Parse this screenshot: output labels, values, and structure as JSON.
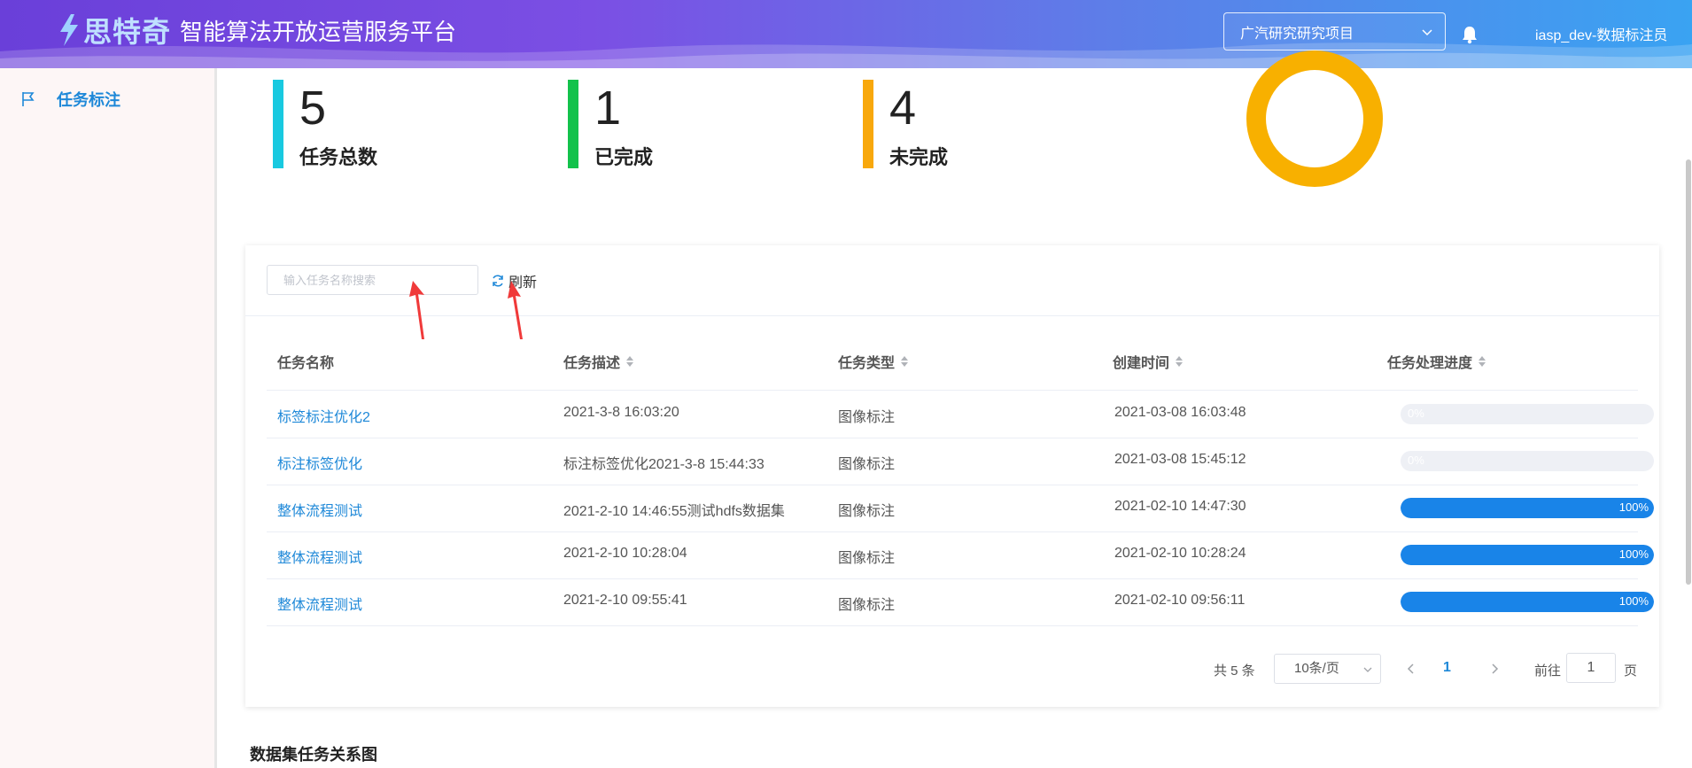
{
  "header": {
    "brand_name": "思特奇",
    "platform_title": "智能算法开放运营服务平台",
    "project_select": "广汽研究研究项目",
    "user_name": "iasp_dev-数据标注员",
    "colors": {
      "gradient_start": "#6a3fd9",
      "gradient_end": "#3aa3f2"
    }
  },
  "sidebar": {
    "items": [
      {
        "label": "任务标注",
        "icon": "flag-icon"
      }
    ]
  },
  "stats": [
    {
      "value": "5",
      "label": "任务总数",
      "color": "#18c9e0"
    },
    {
      "value": "1",
      "label": "已完成",
      "color": "#13c24b"
    },
    {
      "value": "4",
      "label": "未完成",
      "color": "#f8a80c"
    }
  ],
  "donut": {
    "color": "#f8b000",
    "completed": 1,
    "total": 5
  },
  "search": {
    "placeholder": "输入任务名称搜索"
  },
  "toolbar": {
    "refresh_label": "刷新"
  },
  "table": {
    "columns": [
      "任务名称",
      "任务描述",
      "任务类型",
      "创建时间",
      "任务处理进度"
    ],
    "rows": [
      {
        "name": "标签标注优化2",
        "description": "2021-3-8 16:03:20",
        "type": "图像标注",
        "created": "2021-03-08 16:03:48",
        "progress": 0,
        "progress_text": "0%"
      },
      {
        "name": "标注标签优化",
        "description": "标注标签优化2021-3-8 15:44:33",
        "type": "图像标注",
        "created": "2021-03-08 15:45:12",
        "progress": 0,
        "progress_text": "0%"
      },
      {
        "name": "整体流程测试",
        "description": "2021-2-10 14:46:55测试hdfs数据集",
        "type": "图像标注",
        "created": "2021-02-10 14:47:30",
        "progress": 100,
        "progress_text": "100%"
      },
      {
        "name": "整体流程测试",
        "description": "2021-2-10 10:28:04",
        "type": "图像标注",
        "created": "2021-02-10 10:28:24",
        "progress": 100,
        "progress_text": "100%"
      },
      {
        "name": "整体流程测试",
        "description": "2021-2-10 09:55:41",
        "type": "图像标注",
        "created": "2021-02-10 09:56:11",
        "progress": 100,
        "progress_text": "100%"
      }
    ]
  },
  "pagination": {
    "total_text": "共 5 条",
    "page_size": "10条/页",
    "current_page": "1",
    "goto_label": "前往",
    "goto_value": "1",
    "page_unit": "页"
  },
  "section": {
    "title": "数据集任务关系图"
  }
}
